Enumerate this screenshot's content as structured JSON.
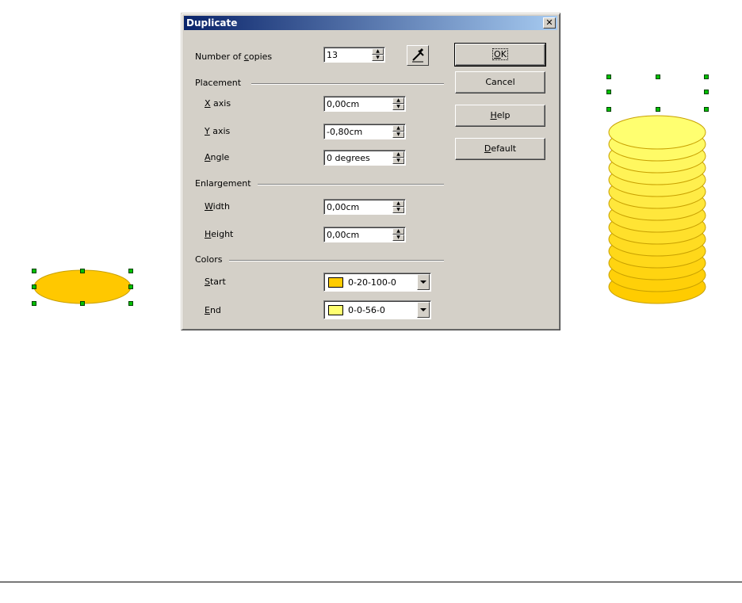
{
  "dialog": {
    "title": "Duplicate",
    "copies": {
      "label_pre": "Number of ",
      "label_ul": "c",
      "label_post": "opies",
      "value": "13"
    },
    "placement": {
      "label": "Placement",
      "x_axis": {
        "ul": "X",
        "post": " axis",
        "value": "0,00cm"
      },
      "y_axis": {
        "ul": "Y",
        "post": " axis",
        "value": "-0,80cm"
      },
      "angle": {
        "ul": "A",
        "post": "ngle",
        "value": "0 degrees"
      }
    },
    "enlargement": {
      "label": "Enlargement",
      "width": {
        "ul": "W",
        "post": "idth",
        "value": "0,00cm"
      },
      "height": {
        "ul": "H",
        "post": "eight",
        "value": "0,00cm"
      }
    },
    "colors": {
      "label": "Colors",
      "start": {
        "ul": "S",
        "post": "tart",
        "value": "0-20-100-0",
        "swatch": "#ffcc00"
      },
      "end": {
        "ul": "E",
        "post": "nd",
        "value": "0-0-56-0",
        "swatch": "#ffff70"
      }
    },
    "buttons": {
      "ok": {
        "ul": "O",
        "post": "K"
      },
      "cancel": "Cancel",
      "help": {
        "ul": "H",
        "post": "elp"
      },
      "default": {
        "ul": "D",
        "post": "efault"
      }
    }
  },
  "shapes": {
    "original_fill": "#ffc800",
    "copies_count": 13,
    "start_color": "#ffcc00",
    "end_color": "#ffff70"
  }
}
